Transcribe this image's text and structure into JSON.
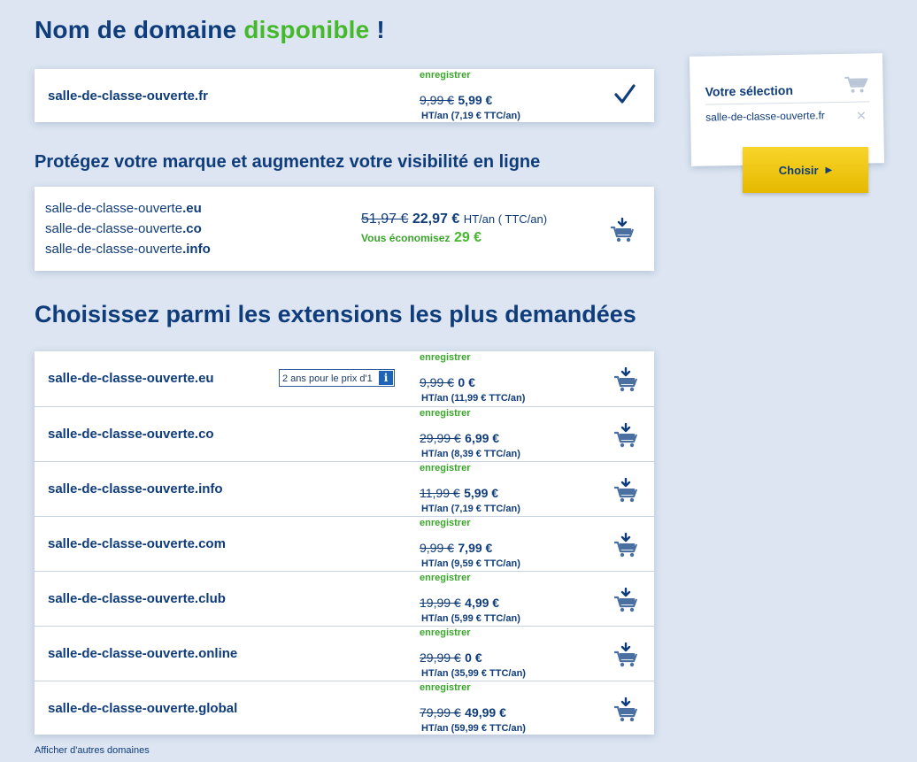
{
  "hero": {
    "prefix": "Nom de domaine",
    "highlight": "disponible",
    "suffix": "!"
  },
  "available": {
    "domain": "salle-de-classe-ouverte.fr",
    "label": "enregistrer",
    "old_price": "9,99 €",
    "new_price": "5,99 €",
    "ht": "HT/an (7,19 € TTC/an)"
  },
  "bundle_title": "Protégez votre marque et augmentez votre visibilité en ligne",
  "bundle": {
    "base": "salle-de-classe-ouverte",
    "exts": [
      ".eu",
      ".co",
      ".info"
    ],
    "old_price": "51,97 €",
    "new_price": "22,97 €",
    "unit": "HT/an ( TTC/an)",
    "savings_label": "Vous économisez",
    "savings": "29 €"
  },
  "list_title": "Choisissez parmi les extensions les plus demandées",
  "promo_badge": "2 ans pour le prix d'1",
  "promo_icon": "i",
  "extensions": [
    {
      "domain": "salle-de-classe-ouverte.eu",
      "label": "enregistrer",
      "old_price": "9,99 €",
      "new_price": "0 €",
      "ht": "HT/an (11,99 € TTC/an)"
    },
    {
      "domain": "salle-de-classe-ouverte.co",
      "label": "enregistrer",
      "old_price": "29,99 €",
      "new_price": "6,99 €",
      "ht": "HT/an (8,39 € TTC/an)"
    },
    {
      "domain": "salle-de-classe-ouverte.info",
      "label": "enregistrer",
      "old_price": "11,99 €",
      "new_price": "5,99 €",
      "ht": "HT/an (7,19 € TTC/an)"
    },
    {
      "domain": "salle-de-classe-ouverte.com",
      "label": "enregistrer",
      "old_price": "9,99 €",
      "new_price": "7,99 €",
      "ht": "HT/an (9,59 € TTC/an)"
    },
    {
      "domain": "salle-de-classe-ouverte.club",
      "label": "enregistrer",
      "old_price": "19,99 €",
      "new_price": "4,99 €",
      "ht": "HT/an (5,99 € TTC/an)"
    },
    {
      "domain": "salle-de-classe-ouverte.online",
      "label": "enregistrer",
      "old_price": "29,99 €",
      "new_price": "0 €",
      "ht": "HT/an (35,99 € TTC/an)"
    },
    {
      "domain": "salle-de-classe-ouverte.global",
      "label": "enregistrer",
      "old_price": "79,99 €",
      "new_price": "49,99 €",
      "ht": "HT/an (59,99 € TTC/an)"
    }
  ],
  "more_link": "Afficher d'autres domaines",
  "selection": {
    "title": "Votre sélection",
    "item": "salle-de-classe-ouverte.fr",
    "button": "Choisir"
  },
  "colors": {
    "accent": "#0f3c7a",
    "green": "#45b82c",
    "yellow": "#f2c80f",
    "background": "#dce5f1"
  },
  "icons": {
    "check": "checkmark-icon",
    "cart": "add-to-cart-icon",
    "remove": "close-icon",
    "arrow": "caret-right-icon"
  }
}
